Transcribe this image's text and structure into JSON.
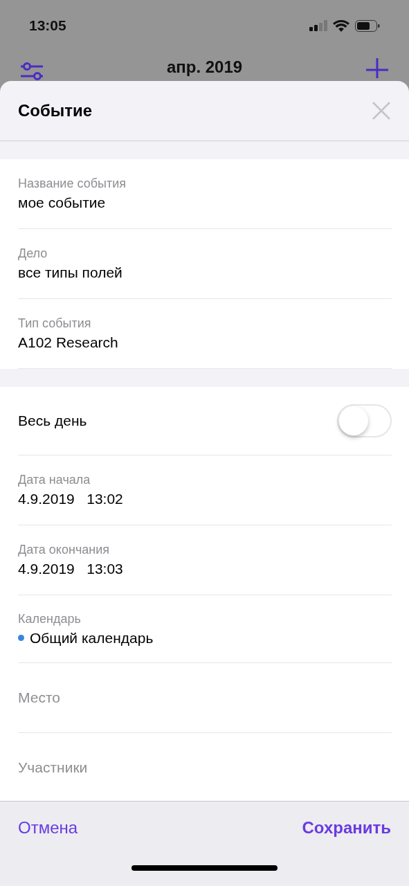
{
  "status_bar": {
    "time": "13:05"
  },
  "nav": {
    "title": "апр. 2019"
  },
  "sheet": {
    "title": "Событие",
    "sections": [
      [
        {
          "kind": "field",
          "label": "Название события",
          "value": "мое событие"
        },
        {
          "kind": "field",
          "label": "Дело",
          "value": "все типы полей"
        },
        {
          "kind": "field",
          "label": "Тип события",
          "value": "A102 Research"
        }
      ],
      [
        {
          "kind": "toggle",
          "label": "Весь день",
          "on": false
        },
        {
          "kind": "field",
          "label": "Дата начала",
          "value": "4.9.2019   13:02"
        },
        {
          "kind": "field",
          "label": "Дата окончания",
          "value": "4.9.2019   13:03"
        },
        {
          "kind": "calendar",
          "label": "Календарь",
          "value": "Общий календарь",
          "color": "#3a84e0"
        },
        {
          "kind": "empty",
          "placeholder": "Место"
        },
        {
          "kind": "empty",
          "placeholder": "Участники"
        }
      ]
    ],
    "cancel": "Отмена",
    "save": "Сохранить"
  }
}
